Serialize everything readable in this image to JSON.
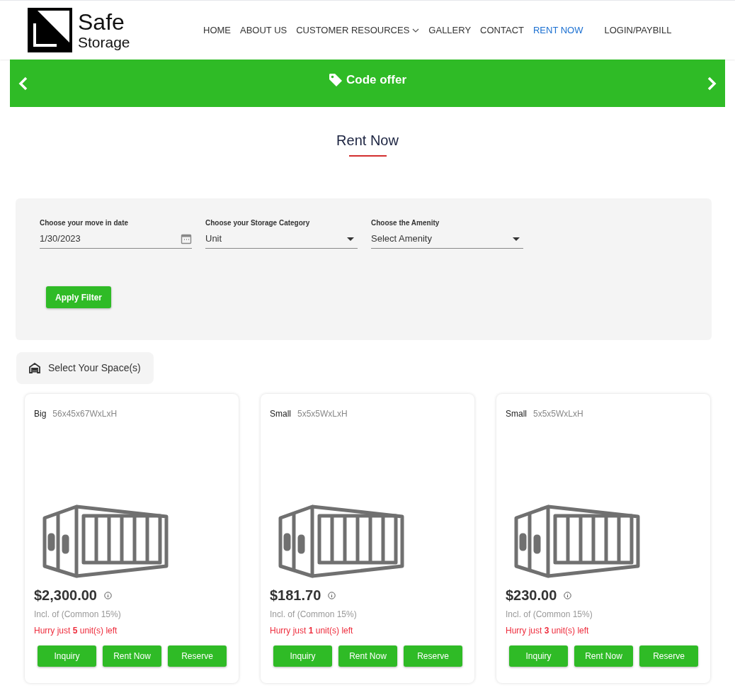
{
  "logo": {
    "line_1": "Safe",
    "line_2": "Storage"
  },
  "nav": [
    {
      "label": "HOME",
      "selected": false
    },
    {
      "label": "ABOUT US",
      "selected": false
    },
    {
      "label": "CUSTOMER RESOURCES",
      "selected": false,
      "dropdown": true
    },
    {
      "label": "GALLERY",
      "selected": false
    },
    {
      "label": "CONTACT",
      "selected": false
    },
    {
      "label": "RENT NOW",
      "selected": true
    },
    {
      "label": "LOGIN/PAYBILL",
      "selected": false
    }
  ],
  "banner": {
    "text": "Code offer"
  },
  "page_title": "Rent Now",
  "filters": [
    {
      "kind": "date",
      "label": "Choose your move in date",
      "value": "1/30/2023"
    },
    {
      "kind": "select",
      "label": "Choose your Storage Category",
      "value": "Unit"
    },
    {
      "kind": "select",
      "label": "Choose the Amenity",
      "value": "Select Amenity"
    }
  ],
  "apply_button": "Apply Filter",
  "section_chip": "Select Your Space(s)",
  "units": [
    {
      "size": "Big",
      "dimensions": "56x45x67WxLxH",
      "price": "$2,300.00",
      "tax_note": "Incl. of (Common 15%)",
      "stock": "Hurry just **5** unit(s) left",
      "buttons": [
        "Inquiry",
        "Rent Now",
        "Reserve"
      ]
    },
    {
      "size": "Small",
      "dimensions": "5x5x5WxLxH",
      "price": "$181.70",
      "tax_note": "Incl. of (Common 15%)",
      "stock": "Hurry just **1** unit(s) left",
      "buttons": [
        "Inquiry",
        "Rent Now",
        "Reserve"
      ]
    },
    {
      "size": "Small",
      "dimensions": "5x5x5WxLxH",
      "price": "$230.00",
      "tax_note": "Incl. of (Common 15%)",
      "stock": "Hurry just **3** unit(s) left",
      "buttons": [
        "Inquiry",
        "Rent Now",
        "Reserve"
      ]
    }
  ]
}
